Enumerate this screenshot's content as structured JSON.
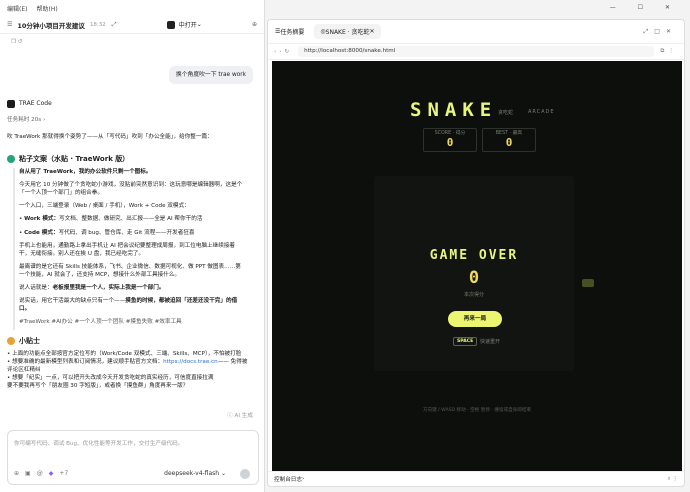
{
  "menu": [
    "编辑(E)",
    "帮助(H)"
  ],
  "window": {
    "controls": "—  ☐  ✕"
  },
  "chat_header": {
    "title": "10分钟小项目开发建议",
    "time": "18:32",
    "mode": "中打开"
  },
  "user_message": "换个角度吹一下 trae work",
  "agent": {
    "name": "TRAE Code",
    "duration": "任务耗时 20s ›"
  },
  "reply": {
    "intro": "吹 TraeWork 那就得换个姿势了——从「写代码」吹到「办公全能」，给你整一篇：",
    "section1": "粘子文案（水贴 · TraeWork 版）",
    "p1": "自从用了 TraeWork，我的办公软件只剩一个图标。",
    "p2": "今天用它 10 分钟做了个贪吃蛇小游戏，没贴前突然意识到：这玩意哪是编辑器啊，这是个「一个人顶一个部门」的组合拳。",
    "p3": "一个入口，三端登录（Web / 桌面 / 手机），Work + Code 双模式：",
    "li1_b": "Work 模式：",
    "li1": "写文档、整数据、做研究、出汇报——全是 AI 帮你干的活",
    "li2_b": "Code 模式：",
    "li2": "写代码、调 bug、管仓库、走 Git 流程——开发者狂喜",
    "p4": "手机上也能用，通勤路上拿出手机让 AI 把会议纪要整理成周报，到工位电脑上继续接着干，无缝衔接。别人还在挨 U 盘，我已经吃完了。",
    "p5": "最离谱的是它还有 Skills 技能体系，飞书、企业微信、数据可视化、做 PPT 做图表……第一个技能，AI 就会了，还支持 MCP，想接什么外部工具接什么。",
    "p6": "说人话就是：",
    "p6b": "老板报里我是一个人，实际上我是一个部门。",
    "p7a": "说实话，用它干活最大的缺点只有一个——",
    "p7b": "摸鱼的时候，都被迫回「还差还没干完」的借口。",
    "tags": "#TraeWork #AI办公 #一个人顶一个团队 #摸鱼失败 #效率工具",
    "section2": "小贴士",
    "t1": "上面的功能点全部按官方定位写的（Work/Code 双模式、三端、Skills、MCP），不怕被打脸",
    "t2a": "想要准确的最新模型列表和订阅情况，建议顺手贴官方文档：",
    "t2link": "https://docs.trae.cn",
    "t2b": "—— 免得被评论区杠精纠",
    "t3": "想要「纪实」一点，可以把开头改成今天开发贪吃蛇的真实经历，可信度直接拉满",
    "closing": "要不要我再写个「朋友圈 30 字短版」，或者换「摸鱼群」角度再来一版？",
    "gen": "AI 生成"
  },
  "input": {
    "placeholder": "你可编写代码、调试 Bug、优化性能等开发工作，交付生产级代码。",
    "extra": "+7",
    "model": "deepseek-v4-flash"
  },
  "browser": {
    "tab1": "任务摘要",
    "tab2": "SNAKE · 贪吃蛇",
    "url": "http://localhost:8000/snake.html",
    "console": "控制台日志"
  },
  "game": {
    "title": "SNAKE",
    "subtitle": "贪吃蛇",
    "arcade": "ARCADE",
    "score_label": "SCORE · 得分",
    "score": "0",
    "best_label": "BEST · 最高",
    "best": "0",
    "over": "GAME OVER",
    "final_score": "0",
    "final_label": "本次得分",
    "again": "再来一局",
    "space": "SPACE",
    "space_hint": "快速重开",
    "footer": "方向键 / WASD 移动 · 空格 暂停 · 撞墙或自身即结束"
  }
}
